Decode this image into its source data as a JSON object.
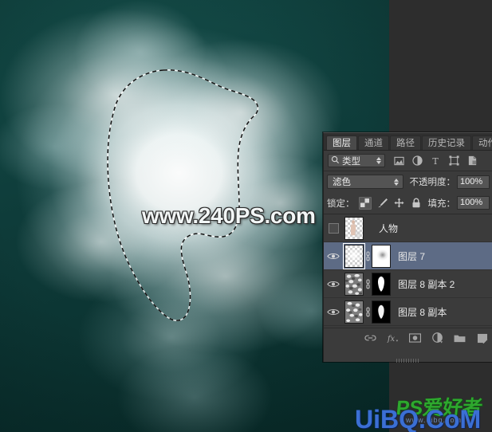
{
  "canvas": {
    "selection_label": "marching-ants-selection",
    "background_color": "#0f3d3a",
    "fog_color": "#ffffff"
  },
  "watermarks": {
    "center": "www.240PS.com",
    "bottom_main": "UiBQ.CoM",
    "bottom_logo": "PS爱好者",
    "bottom_sub": "www.uibq.com"
  },
  "panel": {
    "tabs": [
      {
        "label": "图层",
        "active": true
      },
      {
        "label": "通道",
        "active": false
      },
      {
        "label": "路径",
        "active": false
      },
      {
        "label": "历史记录",
        "active": false
      },
      {
        "label": "动作",
        "active": false
      }
    ],
    "filter": {
      "search_icon": "search-icon",
      "kind_label": "类型",
      "icons": [
        "pixel-layer-filter-icon",
        "adjustment-layer-filter-icon",
        "type-layer-filter-icon",
        "shape-layer-filter-icon",
        "smart-object-filter-icon"
      ]
    },
    "blend": {
      "mode": "滤色",
      "opacity_label": "不透明度：",
      "opacity_value": "100%"
    },
    "lock": {
      "label": "锁定：",
      "icons": [
        "lock-transparent-pixels-icon",
        "lock-image-pixels-icon",
        "lock-position-icon",
        "lock-all-icon"
      ],
      "fill_label": "填充：",
      "fill_value": "100%"
    },
    "layers": [
      {
        "name": "人物",
        "visible": false,
        "selected": false,
        "has_mask": false,
        "thumb": "person",
        "mask": ""
      },
      {
        "name": "图层 7",
        "visible": true,
        "selected": true,
        "has_mask": true,
        "thumb": "empty",
        "mask": "white-blob"
      },
      {
        "name": "图层 8 副本 2",
        "visible": true,
        "selected": false,
        "has_mask": true,
        "thumb": "clouds",
        "mask": "black-blob"
      },
      {
        "name": "图层 8 副本",
        "visible": true,
        "selected": false,
        "has_mask": true,
        "thumb": "clouds",
        "mask": "black-blob"
      }
    ],
    "bottom_icons": [
      "link-layers-icon",
      "layer-style-fx-icon",
      "add-layer-mask-icon",
      "new-adjustment-layer-icon",
      "new-group-icon",
      "new-layer-icon"
    ]
  }
}
